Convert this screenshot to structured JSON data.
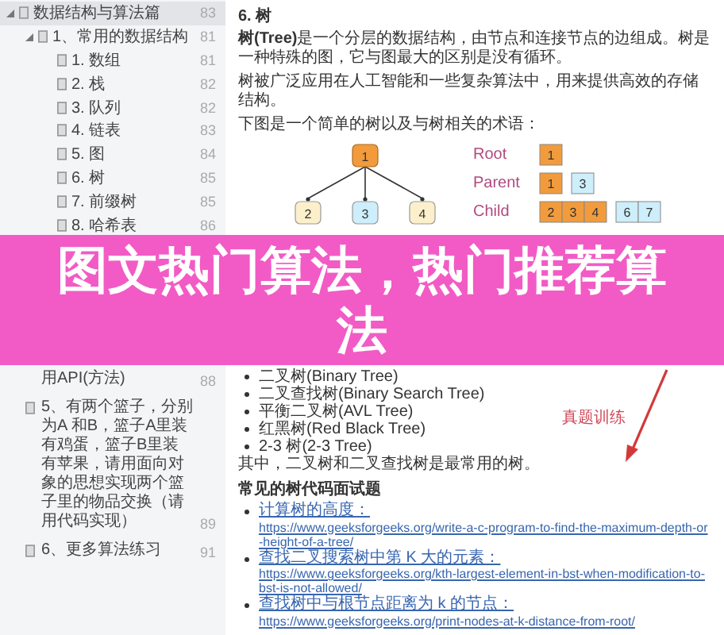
{
  "outline": {
    "items": [
      {
        "label": "数据结构与算法篇",
        "page": "83",
        "selected": true,
        "expanded": true,
        "children": [
          {
            "label": "1、常用的数据结构",
            "page": "81",
            "selected": false,
            "expanded": true,
            "children": [
              {
                "label": "1. 数组",
                "page": "81",
                "selected": false
              },
              {
                "label": "2. 栈",
                "page": "82",
                "selected": false
              },
              {
                "label": "3. 队列",
                "page": "82",
                "selected": false
              },
              {
                "label": "4. 链表",
                "page": "83",
                "selected": false
              },
              {
                "label": "5. 图",
                "page": "84",
                "selected": false
              },
              {
                "label": "6. 树",
                "page": "85",
                "selected": false
              },
              {
                "label": "7. 前缀树",
                "page": "85",
                "selected": false
              },
              {
                "label": "8. 哈希表",
                "page": "86",
                "selected": false
              }
            ]
          }
        ]
      }
    ],
    "after_banner_items": [
      {
        "kind": "continuation",
        "label": "用API(方法)",
        "page": "88"
      },
      {
        "kind": "entry",
        "label": "5、有两个篮子，分别为A 和B，篮子A里装有鸡蛋，篮子B里装有苹果，请用面向对象的思想实现两个篮子里的物品交换（请用代码实现）",
        "page": "89"
      },
      {
        "kind": "entry",
        "label": "6、更多算法练习",
        "page": "91"
      }
    ]
  },
  "document_top": {
    "heading": "6. 树",
    "paragraphs": [
      "**树(Tree)**是一个分层的数据结构，由节点和连接节点的边组成。树是一种特殊的图，它与图最大的区别是没有循环。",
      "树被广泛应用在人工智能和一些复杂算法中，用来提供高效的存储结构。",
      "下图是一个简单的树以及与树相关的术语："
    ],
    "diagram": {
      "tree": {
        "label": "1",
        "color": "#f29b3c",
        "children": [
          {
            "label": "2",
            "color": "#fcf0cc"
          },
          {
            "label": "3",
            "color": "#cdeefa"
          },
          {
            "label": "4",
            "color": "#fcf0cc"
          }
        ]
      },
      "legend": [
        {
          "term": "Root",
          "groups": [
            {
              "color": "#f29b3c",
              "cells": [
                "1"
              ]
            }
          ]
        },
        {
          "term": "Parent",
          "groups": [
            {
              "color": "#f29b3c",
              "cells": [
                "1"
              ]
            },
            {
              "color": "#cdeefa",
              "cells": [
                "3"
              ]
            }
          ]
        },
        {
          "term": "Child",
          "groups": [
            {
              "color": "#f29b3c",
              "cells": [
                "2",
                "3",
                "4"
              ]
            },
            {
              "color": "#cdeefa",
              "cells": [
                "6",
                "7"
              ]
            }
          ]
        }
      ]
    }
  },
  "banner": {
    "title": "图文热门算法，热门推荐算法"
  },
  "document_bottom": {
    "list": [
      "二叉树(Binary Tree)",
      "二叉查找树(Binary Search Tree)",
      "平衡二叉树(AVL Tree)",
      "红黑树(Red Black Tree)",
      "2-3 树(2-3 Tree)"
    ],
    "sentence": "其中，二叉树和二叉查找树是最常用的树。",
    "heading": "常见的树代码面试题",
    "annotation": "真题训练",
    "links": [
      {
        "title": "计算树的高度：",
        "url": "https://www.geeksforgeeks.org/write-a-c-program-to-find-the-maximum-depth-or-height-of-a-tree/"
      },
      {
        "title": "查找二叉搜索树中第 K 大的元素：",
        "url": "https://www.geeksforgeeks.org/kth-largest-element-in-bst-when-modification-to-bst-is-not-allowed/"
      },
      {
        "title": "查找树中与根节点距离为 k 的节点：",
        "url": "https://www.geeksforgeeks.org/print-nodes-at-k-distance-from-root/"
      }
    ]
  }
}
